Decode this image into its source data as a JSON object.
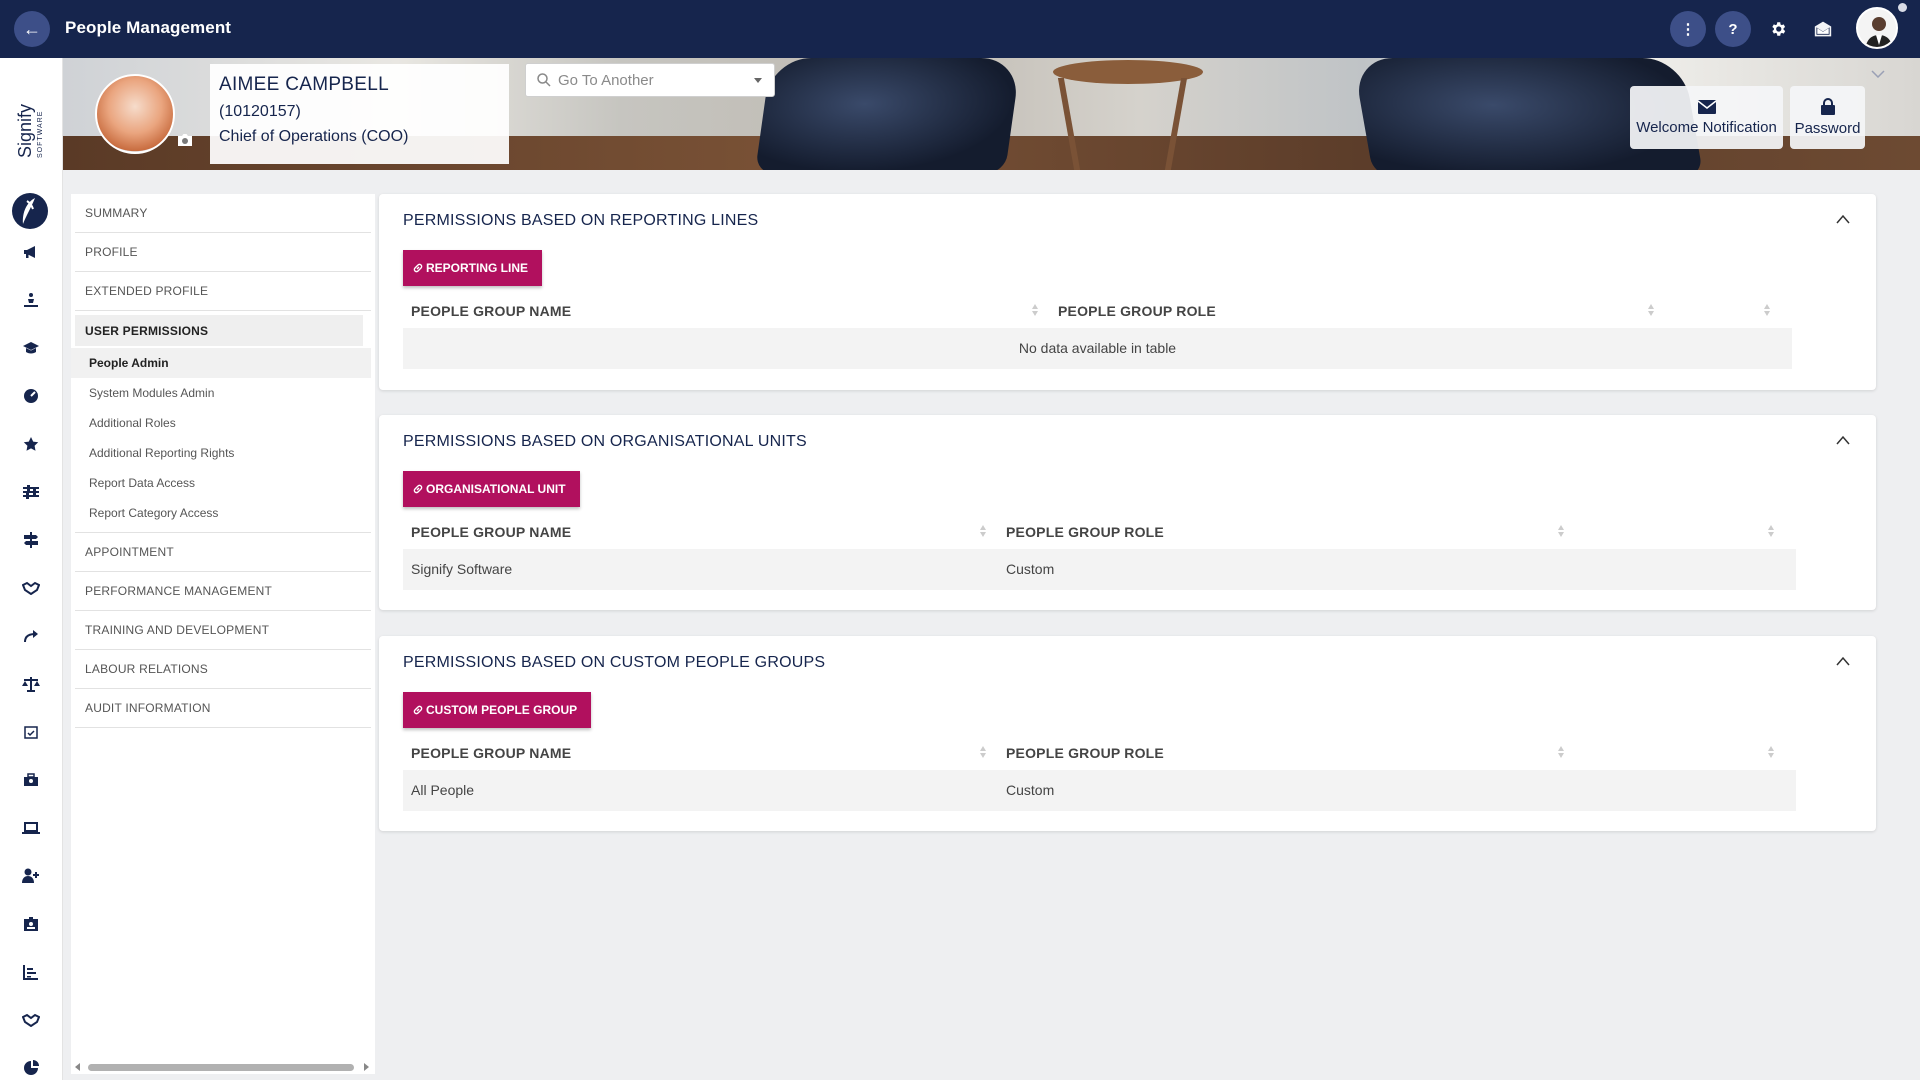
{
  "topbar": {
    "back_label": "←",
    "title": "People Management",
    "more_label": "⋮",
    "help_label": "?"
  },
  "logo": {
    "text": "Signify",
    "sub": "SOFTWARE"
  },
  "person": {
    "name": "AIMEE CAMPBELL",
    "id": "(10120157)",
    "role": "Chief of Operations (COO)"
  },
  "goto": {
    "placeholder": "Go To Another"
  },
  "banner_buttons": {
    "welcome": "Welcome Notification",
    "password": "Password"
  },
  "nav": {
    "items_top": [
      "SUMMARY",
      "PROFILE",
      "EXTENDED PROFILE"
    ],
    "active": "USER PERMISSIONS",
    "subitems": [
      "People Admin",
      "System Modules Admin",
      "Additional Roles",
      "Additional Reporting Rights",
      "Report Data Access",
      "Report Category Access"
    ],
    "active_sub": "People Admin",
    "items_bottom": [
      "APPOINTMENT",
      "PERFORMANCE MANAGEMENT",
      "TRAINING AND DEVELOPMENT",
      "LABOUR RELATIONS",
      "AUDIT INFORMATION"
    ]
  },
  "cards": [
    {
      "title": "PERMISSIONS BASED ON REPORTING LINES",
      "button": "REPORTING LINE",
      "columns": [
        "PEOPLE GROUP NAME",
        "PEOPLE GROUP ROLE"
      ],
      "empty_text": "No data available in table",
      "rows": []
    },
    {
      "title": "PERMISSIONS BASED ON ORGANISATIONAL UNITS",
      "button": "ORGANISATIONAL UNIT",
      "columns": [
        "PEOPLE GROUP NAME",
        "PEOPLE GROUP ROLE"
      ],
      "rows": [
        [
          "Signify Software",
          "Custom"
        ]
      ]
    },
    {
      "title": "PERMISSIONS BASED ON CUSTOM PEOPLE GROUPS",
      "button": "CUSTOM PEOPLE GROUP",
      "columns": [
        "PEOPLE GROUP NAME",
        "PEOPLE GROUP ROLE"
      ],
      "rows": [
        [
          "All People",
          "Custom"
        ]
      ]
    }
  ],
  "colors": {
    "topbar": "#16254d",
    "accent": "#b1105e",
    "circle_button": "#3d4f88"
  },
  "rail_icons": [
    "megaphone-icon",
    "person-meditate-icon",
    "graduation-cap-icon",
    "gauge-icon",
    "star-icon",
    "sliders-icon",
    "signpost-icon",
    "handshake-icon",
    "route-icon",
    "scales-icon",
    "calendar-check-icon",
    "briefcase-user-icon",
    "laptop-icon",
    "user-plus-icon",
    "id-badge-icon",
    "chart-bar-icon",
    "handshake-alt-icon",
    "pie-chart-icon"
  ]
}
